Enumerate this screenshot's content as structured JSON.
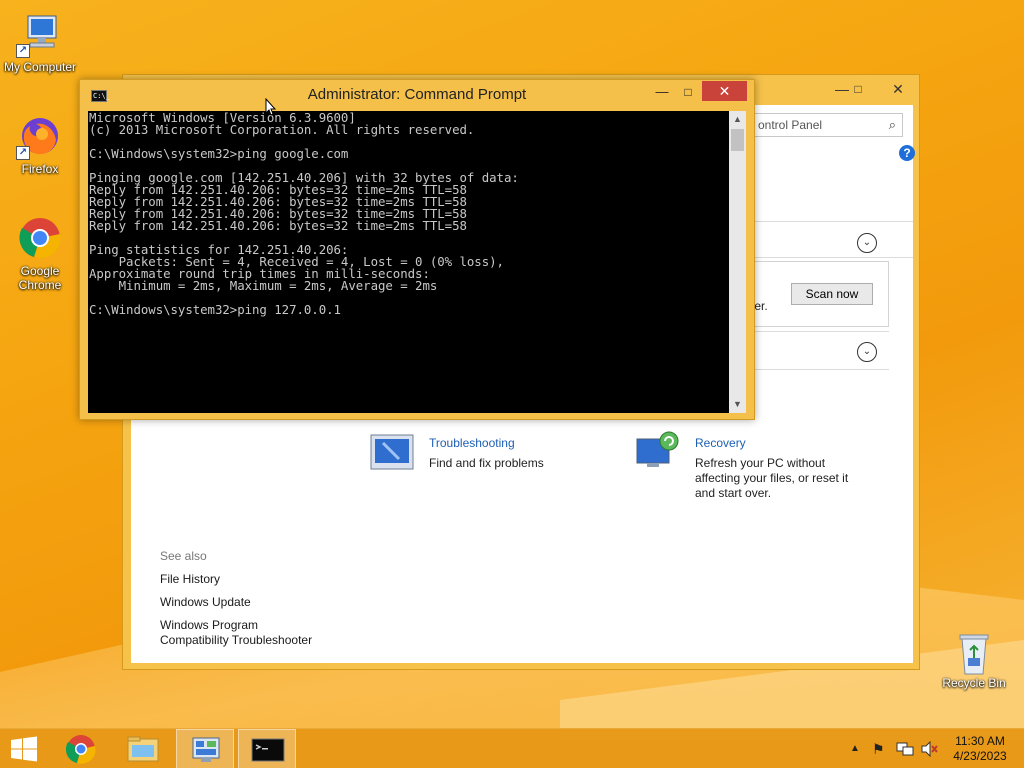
{
  "desktop": {
    "icons": [
      {
        "label": "My Computer",
        "icon": "computer-icon"
      },
      {
        "label": "Firefox",
        "icon": "firefox-icon"
      },
      {
        "label": "Google Chrome",
        "icon": "chrome-icon"
      },
      {
        "label": "Recycle Bin",
        "icon": "recycle-bin-icon"
      }
    ]
  },
  "control_panel": {
    "search_placeholder": "ontrol Panel",
    "help": "?",
    "partial_text": "ter.",
    "scan_button": "Scan now",
    "troubleshooting": {
      "title": "Troubleshooting",
      "desc": "Find and fix problems"
    },
    "recovery": {
      "title": "Recovery",
      "desc1": "Refresh your PC without",
      "desc2": "affecting your files, or reset it",
      "desc3": "and start over."
    },
    "see_also": "See also",
    "links": [
      "File History",
      "Windows Update",
      "Windows Program",
      "Compatibility Troubleshooter"
    ]
  },
  "cmd": {
    "title": "Administrator:  Command Prompt",
    "icon_text": "C:\\_",
    "lines": [
      "Microsoft Windows [Version 6.3.9600]",
      "(c) 2013 Microsoft Corporation. All rights reserved.",
      "",
      "C:\\Windows\\system32>ping google.com",
      "",
      "Pinging google.com [142.251.40.206] with 32 bytes of data:",
      "Reply from 142.251.40.206: bytes=32 time=2ms TTL=58",
      "Reply from 142.251.40.206: bytes=32 time=2ms TTL=58",
      "Reply from 142.251.40.206: bytes=32 time=2ms TTL=58",
      "Reply from 142.251.40.206: bytes=32 time=2ms TTL=58",
      "",
      "Ping statistics for 142.251.40.206:",
      "    Packets: Sent = 4, Received = 4, Lost = 0 (0% loss),",
      "Approximate round trip times in milli-seconds:",
      "    Minimum = 2ms, Maximum = 2ms, Average = 2ms",
      "",
      "C:\\Windows\\system32>ping 127.0.0.1"
    ]
  },
  "taskbar": {
    "time": "11:30 AM",
    "date": "4/23/2023"
  },
  "colors": {
    "accent": "#f4c04a",
    "close": "#c9433a",
    "link": "#1e5fb4"
  }
}
